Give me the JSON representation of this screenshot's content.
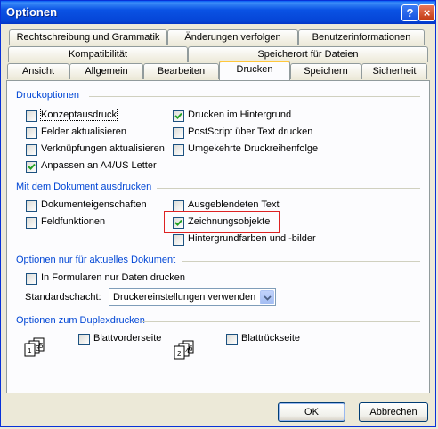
{
  "window": {
    "title": "Optionen",
    "help_symbol": "?",
    "close_symbol": "×"
  },
  "tabs": {
    "row1": [
      "Rechtschreibung und Grammatik",
      "Änderungen verfolgen",
      "Benutzerinformationen"
    ],
    "row2": [
      "Kompatibilität",
      "Speicherort für Dateien"
    ],
    "row3": [
      "Ansicht",
      "Allgemein",
      "Bearbeiten",
      "Drucken",
      "Speichern",
      "Sicherheit"
    ],
    "active": "Drucken"
  },
  "druckoptionen": {
    "title": "Druckoptionen",
    "left": [
      {
        "label": "Konzeptausdruck",
        "checked": false
      },
      {
        "label": "Felder aktualisieren",
        "checked": false
      },
      {
        "label": "Verknüpfungen aktualisieren",
        "checked": false
      },
      {
        "label": "Anpassen an A4/US Letter",
        "checked": true
      }
    ],
    "right": [
      {
        "label": "Drucken im Hintergrund",
        "checked": true
      },
      {
        "label": "PostScript über Text drucken",
        "checked": false
      },
      {
        "label": "Umgekehrte Druckreihenfolge",
        "checked": false
      }
    ]
  },
  "mit_dokument": {
    "title": "Mit dem Dokument ausdrucken",
    "left": [
      {
        "label": "Dokumenteigenschaften",
        "checked": false
      },
      {
        "label": "Feldfunktionen",
        "checked": false
      }
    ],
    "right": [
      {
        "label": "Ausgeblendeten Text",
        "checked": false
      },
      {
        "label": "Zeichnungsobjekte",
        "checked": true
      },
      {
        "label": "Hintergrundfarben und -bilder",
        "checked": false
      }
    ]
  },
  "aktuelles_dokument": {
    "title": "Optionen nur für aktuelles Dokument",
    "formulare": {
      "label": "In Formularen nur Daten drucken",
      "checked": false
    },
    "schacht_label": "Standardschacht:",
    "schacht_value": "Druckereinstellungen verwenden"
  },
  "duplex": {
    "title": "Optionen zum Duplexdrucken",
    "front": {
      "label": "Blattvorderseite",
      "checked": false,
      "pages": [
        "1",
        "3",
        "5"
      ]
    },
    "back": {
      "label": "Blattrückseite",
      "checked": false,
      "pages": [
        "2",
        "4",
        "6"
      ]
    }
  },
  "buttons": {
    "ok": "OK",
    "cancel": "Abbrechen"
  },
  "colors": {
    "titlebar": "#0a52e4",
    "group_title": "#0046d5",
    "highlight_box": "#dd2222",
    "dialog_bg": "#ece9d8"
  }
}
